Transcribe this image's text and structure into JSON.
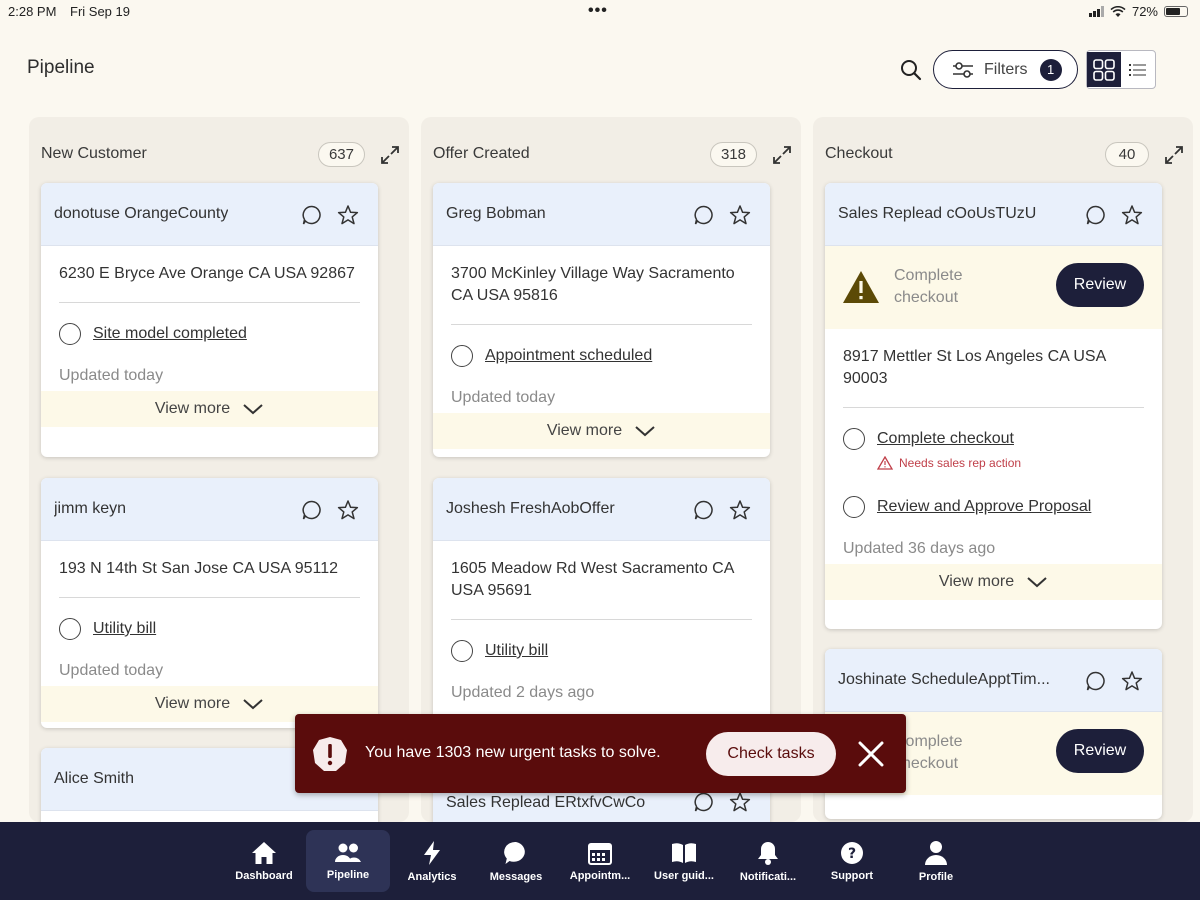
{
  "status_bar": {
    "time": "2:28 PM",
    "date": "Fri Sep 19",
    "battery": "72%"
  },
  "header": {
    "title": "Pipeline",
    "filters_label": "Filters",
    "filters_count": "1"
  },
  "columns": [
    {
      "title": "New Customer",
      "count": "637",
      "cards": [
        {
          "name": "donotuse OrangeCounty",
          "address": "6230 E Bryce Ave Orange CA USA 92867",
          "task": "Site model completed",
          "updated": "Updated today",
          "view_more": "View more"
        },
        {
          "name": "jimm keyn",
          "address": "193 N 14th St San Jose CA USA 95112",
          "task": "Utility bill",
          "updated": "Updated today",
          "view_more": "View more"
        },
        {
          "name": "Alice Smith"
        }
      ]
    },
    {
      "title": "Offer Created",
      "count": "318",
      "cards": [
        {
          "name": "Greg Bobman",
          "address": "3700 McKinley Village Way Sacramento CA USA 95816",
          "task": "Appointment scheduled",
          "updated": "Updated today",
          "view_more": "View more"
        },
        {
          "name": "Joshesh FreshAobOffer",
          "address": "1605 Meadow Rd West Sacramento CA USA 95691",
          "task": "Utility bill",
          "updated": "Updated 2 days ago"
        },
        {
          "name": "Sales Replead ERtxfvCwCo"
        }
      ]
    },
    {
      "title": "Checkout",
      "count": "40",
      "cards": [
        {
          "name": "Sales Replead cOoUsTUzU",
          "banner_text": "Complete checkout",
          "review": "Review",
          "address": "8917 Mettler St Los Angeles CA USA 90003",
          "task": "Complete checkout",
          "warning": "Needs sales rep action",
          "task2": "Review and Approve Proposal",
          "updated": "Updated 36 days ago",
          "view_more": "View more"
        },
        {
          "name": "Joshinate ScheduleApptTim...",
          "banner_text": "Complete checkout",
          "review": "Review"
        }
      ]
    }
  ],
  "toast": {
    "message": "You have 1303 new urgent tasks to solve.",
    "button": "Check tasks"
  },
  "nav": [
    "Dashboard",
    "Pipeline",
    "Analytics",
    "Messages",
    "Appointm...",
    "User guid...",
    "Notificati...",
    "Support",
    "Profile"
  ],
  "colors": {
    "navy": "#1d1f3a",
    "toast_bg": "#5a0c0c",
    "card_header": "#e9f0fb",
    "background": "#fbf8f0"
  }
}
